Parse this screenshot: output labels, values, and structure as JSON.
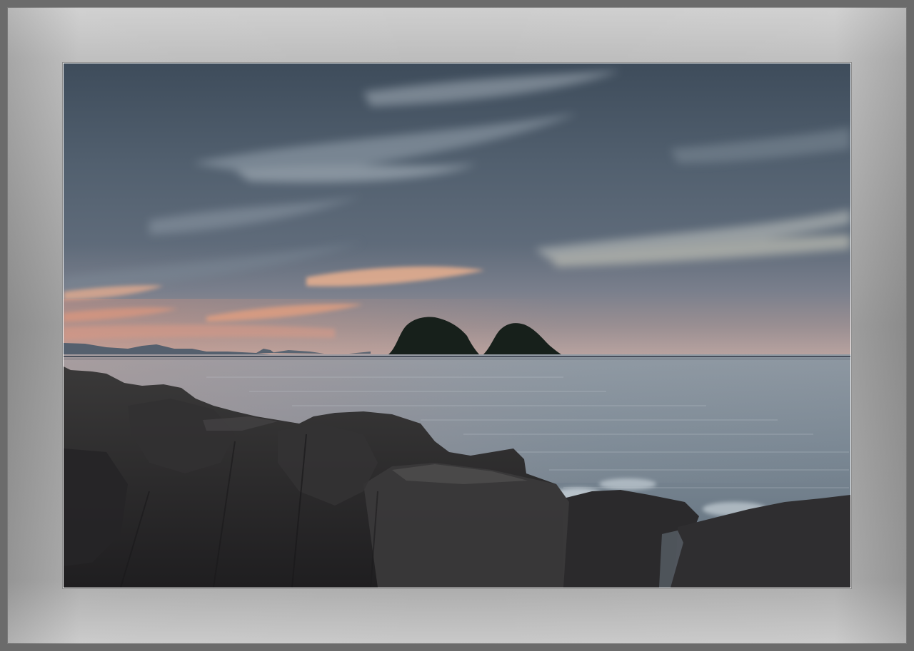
{
  "image": {
    "subject": "",
    "colors": {
      "frame_outer": "#6b6b6b",
      "mat": "#a8a8a8",
      "sky_top": "#3f4d5c",
      "sky_mid": "#5b6b7a",
      "sunset_glow": "#e39a78",
      "sea": "#7f8d99",
      "rocks": "#2b2a2b"
    }
  }
}
